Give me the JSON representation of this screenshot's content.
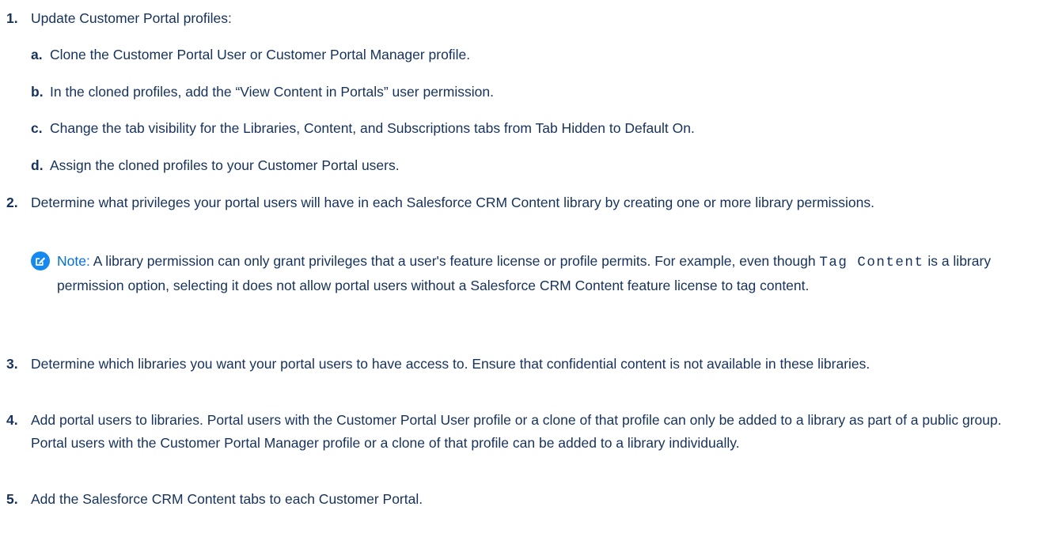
{
  "steps": [
    {
      "number": "1.",
      "text": "Update Customer Portal profiles:",
      "substeps": [
        {
          "letter": "a.",
          "text": "Clone the Customer Portal User or Customer Portal Manager profile."
        },
        {
          "letter": "b.",
          "text": "In the cloned profiles, add the “View Content in Portals” user permission."
        },
        {
          "letter": "c.",
          "text": "Change the tab visibility for the Libraries, Content, and Subscriptions tabs from Tab Hidden to Default On."
        },
        {
          "letter": "d.",
          "text": "Assign the cloned profiles to your Customer Portal users."
        }
      ]
    },
    {
      "number": "2.",
      "text": "Determine what privileges your portal users will have in each Salesforce CRM Content library by creating one or more library permissions."
    },
    {
      "number": "3.",
      "text": "Determine which libraries you want your portal users to have access to. Ensure that confidential content is not available in these libraries."
    },
    {
      "number": "4.",
      "text": "Add portal users to libraries. Portal users with the Customer Portal User profile or a clone of that profile can only be added to a library as part of a public group. Portal users with the Customer Portal Manager profile or a clone of that profile can be added to a library individually."
    },
    {
      "number": "5.",
      "text": "Add the Salesforce CRM Content tabs to each Customer Portal."
    }
  ],
  "note": {
    "icon": "note-edit-icon",
    "icon_color": "#1589ee",
    "label": "Note:",
    "text_before": "A library permission can only grant privileges that a user's feature license or profile permits. For example, even though",
    "code": "Tag Content",
    "text_after": "is a library permission option, selecting it does not allow portal users without a Salesforce CRM Content feature license to tag content."
  },
  "colors": {
    "text": "#16325c",
    "note_label": "#0070d2"
  }
}
